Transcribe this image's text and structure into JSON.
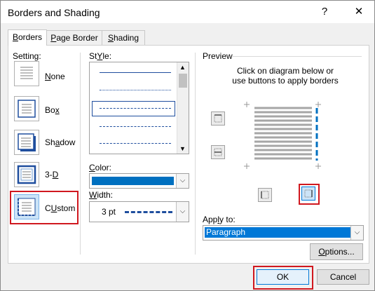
{
  "title": "Borders and Shading",
  "title_buttons": {
    "help": "?",
    "close": "✕"
  },
  "tabs": [
    {
      "label": "Borders",
      "mn": "B",
      "rest": "orders"
    },
    {
      "label": "Page Border",
      "mn": "P",
      "rest": "age Border"
    },
    {
      "label": "Shading",
      "mn": "S",
      "rest": "hading"
    }
  ],
  "setting": {
    "heading": "Setting:",
    "items": [
      {
        "label": "None",
        "mn": "N",
        "rest": "one"
      },
      {
        "label": "Box",
        "mn": "x",
        "pre": "Bo"
      },
      {
        "label": "Shadow",
        "pre": "Sh",
        "mn": "a",
        "rest": "dow"
      },
      {
        "label": "3-D",
        "pre": "3-",
        "mn": "D"
      },
      {
        "label": "Custom",
        "mn": "U",
        "pre": "C",
        "rest": "stom",
        "selected": true
      }
    ]
  },
  "style": {
    "heading_mn": "Y",
    "heading_pre": "St",
    "heading_rest": "le:",
    "selected_index": 2
  },
  "color": {
    "heading_pre": "",
    "heading_mn": "C",
    "heading_rest": "olor:",
    "value_color": "#0070c0"
  },
  "width": {
    "heading_mn": "W",
    "heading_rest": "idth:",
    "value": "3 pt"
  },
  "preview": {
    "heading": "Preview",
    "instructions_line1": "Click on diagram below or",
    "instructions_line2": "use buttons to apply borders"
  },
  "apply_to": {
    "heading_pre": "App",
    "heading_mn": "l",
    "heading_rest": "y to:",
    "value": "Paragraph"
  },
  "buttons": {
    "options_mn": "O",
    "options_rest": "ptions...",
    "ok": "OK",
    "cancel": "Cancel"
  },
  "colors": {
    "accent": "#0070c0",
    "highlight": "#d0181f",
    "select": "#0078d7"
  }
}
